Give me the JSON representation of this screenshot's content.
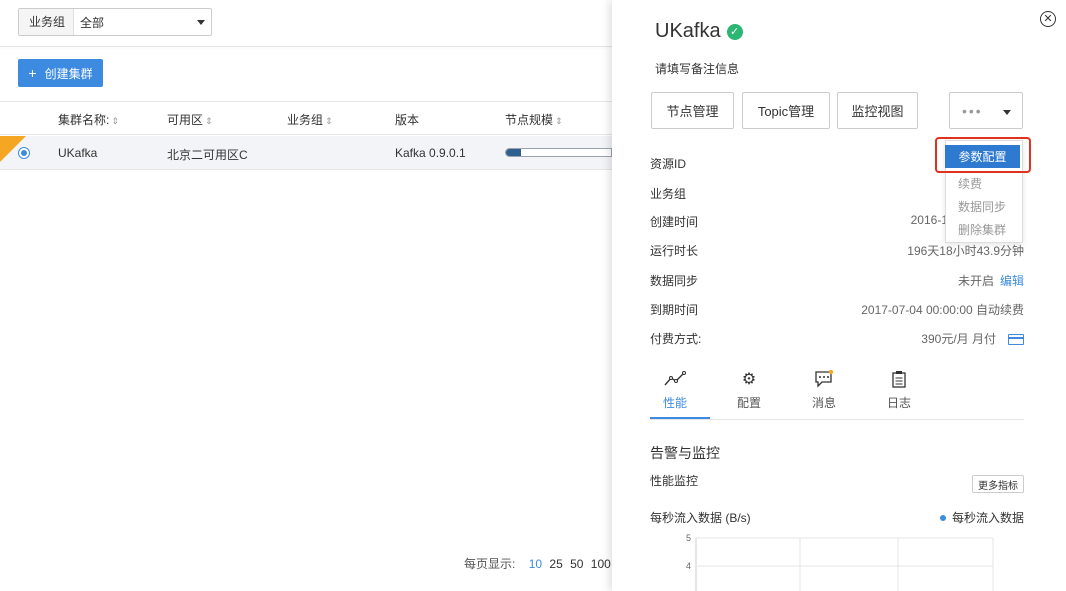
{
  "filter": {
    "label": "业务组",
    "value": "全部"
  },
  "create_button": {
    "icon": "+",
    "label": "创建集群"
  },
  "table": {
    "headers": [
      "集群名称:",
      "可用区",
      "业务组",
      "版本",
      "节点规模"
    ],
    "rows": [
      {
        "name": "UKafka",
        "zone": "北京二可用区C",
        "group": "",
        "version": "Kafka 0.9.0.1",
        "progress": 0.14
      }
    ]
  },
  "pager": {
    "label": "每页显示:",
    "options": [
      "10",
      "25",
      "50",
      "100"
    ],
    "selected": "10"
  },
  "detail": {
    "title": "UKafka",
    "remark": "请填写备注信息",
    "buttons": [
      "节点管理",
      "Topic管理",
      "监控视图"
    ],
    "more": "•••",
    "dropdown": {
      "items": [
        "参数配置",
        "续费",
        "数据同步",
        "删除集群"
      ],
      "active": "参数配置"
    },
    "fields": [
      {
        "key": "资源ID",
        "value": ""
      },
      {
        "key": "业务组",
        "value": ""
      },
      {
        "key": "创建时间",
        "value": "2016-1"
      },
      {
        "key": "运行时长",
        "value": "196天18小时43.9分钟"
      },
      {
        "key": "数据同步",
        "value": "未开启",
        "link": "编辑"
      },
      {
        "key": "到期时间",
        "value": "2017-07-04 00:00:00 自动续费"
      },
      {
        "key": "付费方式:",
        "value": "390元/月 月付"
      }
    ],
    "tabs": [
      {
        "icon": "line-chart-icon",
        "label": "性能"
      },
      {
        "icon": "gear-icon",
        "label": "配置"
      },
      {
        "icon": "message-icon",
        "label": "消息"
      },
      {
        "icon": "clipboard-icon",
        "label": "日志"
      }
    ],
    "section_title": "告警与监控",
    "sub_title": "性能监控",
    "more_metrics": "更多指标",
    "chart_title": "每秒流入数据 (B/s)",
    "legend": "每秒流入数据",
    "accent": "#3d8be0"
  },
  "chart_data": {
    "type": "line",
    "title": "每秒流入数据 (B/s)",
    "series": [
      {
        "name": "每秒流入数据",
        "values": []
      }
    ],
    "yticks": [
      5,
      4
    ],
    "ylim": [
      4,
      5
    ],
    "grid": true
  }
}
